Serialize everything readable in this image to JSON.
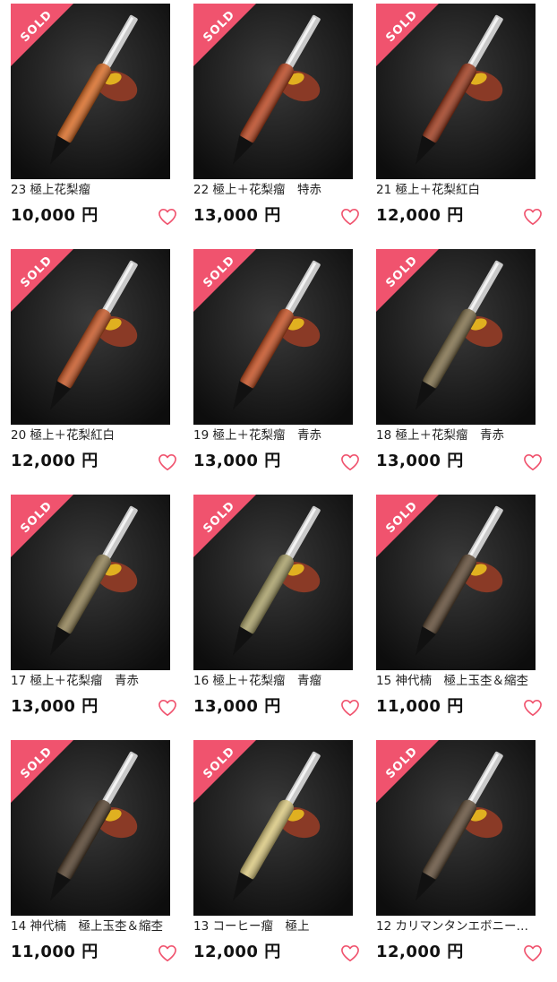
{
  "sold_label": "SOLD",
  "colors": {
    "ribbon": "#f0536e",
    "heart": "#f0536e",
    "background": "#1a1a1a"
  },
  "items": [
    {
      "name": "23 極上花梨瘤",
      "price": "10,000 円",
      "sold": true,
      "wood_color": "#d4651e",
      "icon": "heart-icon"
    },
    {
      "name": "22 極上＋花梨瘤　特赤",
      "price": "13,000 円",
      "sold": true,
      "wood_color": "#b5401a",
      "icon": "heart-icon"
    },
    {
      "name": "21 極上＋花梨紅白",
      "price": "12,000 円",
      "sold": true,
      "wood_color": "#9a3517",
      "icon": "heart-icon"
    },
    {
      "name": "20 極上＋花梨紅白",
      "price": "12,000 円",
      "sold": true,
      "wood_color": "#c2511f",
      "icon": "heart-icon"
    },
    {
      "name": "19 極上＋花梨瘤　青赤",
      "price": "13,000 円",
      "sold": true,
      "wood_color": "#c04a1c",
      "icon": "heart-icon"
    },
    {
      "name": "18 極上＋花梨瘤　青赤",
      "price": "13,000 円",
      "sold": true,
      "wood_color": "#7a6a45",
      "icon": "heart-icon"
    },
    {
      "name": "17 極上＋花梨瘤　青赤",
      "price": "13,000 円",
      "sold": true,
      "wood_color": "#8a7a4e",
      "icon": "heart-icon"
    },
    {
      "name": "16 極上＋花梨瘤　青瘤",
      "price": "13,000 円",
      "sold": true,
      "wood_color": "#a39a62",
      "icon": "heart-icon"
    },
    {
      "name": "15 神代楠　極上玉杢＆縮杢",
      "price": "11,000 円",
      "sold": true,
      "wood_color": "#5a4530",
      "icon": "heart-icon"
    },
    {
      "name": "14 神代楠　極上玉杢＆縮杢",
      "price": "11,000 円",
      "sold": true,
      "wood_color": "#4e3b28",
      "icon": "heart-icon"
    },
    {
      "name": "13 コーヒー瘤　極上",
      "price": "12,000 円",
      "sold": true,
      "wood_color": "#d6c47a",
      "icon": "heart-icon"
    },
    {
      "name": "12 カリマンタンエボニー…",
      "price": "12,000 円",
      "sold": true,
      "wood_color": "#5e4a35",
      "icon": "heart-icon"
    }
  ]
}
